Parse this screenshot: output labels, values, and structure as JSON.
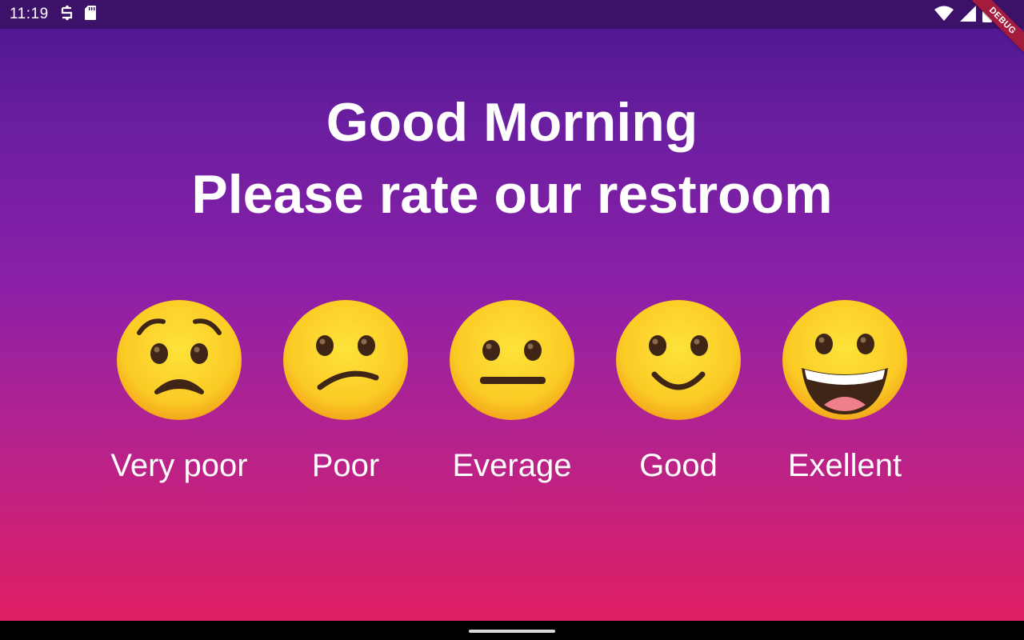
{
  "status_bar": {
    "time": "11:19",
    "icons_left": [
      "sync-icon",
      "sd-card-icon"
    ],
    "icons_right": [
      "wifi-icon",
      "cell-signal-icon",
      "battery-icon"
    ]
  },
  "debug_banner": "DEBUG",
  "headline": {
    "line1": "Good Morning",
    "line2": "Please rate our restroom"
  },
  "ratings": [
    {
      "label": "Very poor",
      "face": "worried-face-icon"
    },
    {
      "label": "Poor",
      "face": "confused-face-icon"
    },
    {
      "label": "Everage",
      "face": "neutral-face-icon"
    },
    {
      "label": "Good",
      "face": "slightly-smiling-face-icon"
    },
    {
      "label": "Exellent",
      "face": "grinning-face-icon"
    }
  ],
  "colors": {
    "status_bar": "#3c1169",
    "gradient_top": "#4a1690",
    "gradient_bottom": "#e01f63",
    "emoji_fill": "#fcd02c",
    "emoji_features": "#3e2515",
    "debug_banner": "#a31b3d"
  }
}
